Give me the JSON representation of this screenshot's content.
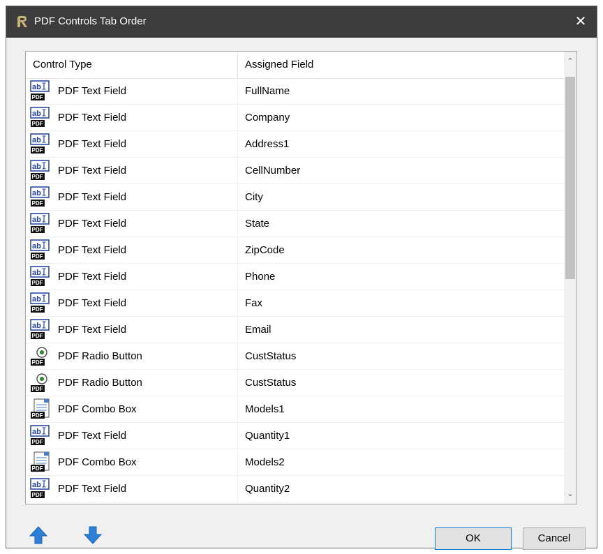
{
  "window": {
    "title": "PDF Controls Tab Order",
    "close_glyph": "✕"
  },
  "list": {
    "columns": [
      "Control Type",
      "Assigned Field"
    ],
    "rows": [
      {
        "type": "PDF Text Field",
        "field": "FullName",
        "icon": "pdf-text-field-icon"
      },
      {
        "type": "PDF Text Field",
        "field": "Company",
        "icon": "pdf-text-field-icon"
      },
      {
        "type": "PDF Text Field",
        "field": "Address1",
        "icon": "pdf-text-field-icon"
      },
      {
        "type": "PDF Text Field",
        "field": "CellNumber",
        "icon": "pdf-text-field-icon"
      },
      {
        "type": "PDF Text Field",
        "field": "City",
        "icon": "pdf-text-field-icon"
      },
      {
        "type": "PDF Text Field",
        "field": "State",
        "icon": "pdf-text-field-icon"
      },
      {
        "type": "PDF Text Field",
        "field": "ZipCode",
        "icon": "pdf-text-field-icon"
      },
      {
        "type": "PDF Text Field",
        "field": "Phone",
        "icon": "pdf-text-field-icon"
      },
      {
        "type": "PDF Text Field",
        "field": "Fax",
        "icon": "pdf-text-field-icon"
      },
      {
        "type": "PDF Text Field",
        "field": "Email",
        "icon": "pdf-text-field-icon"
      },
      {
        "type": "PDF Radio Button",
        "field": "CustStatus",
        "icon": "pdf-radio-button-icon"
      },
      {
        "type": "PDF Radio Button",
        "field": "CustStatus",
        "icon": "pdf-radio-button-icon"
      },
      {
        "type": "PDF Combo Box",
        "field": "Models1",
        "icon": "pdf-combo-box-icon"
      },
      {
        "type": "PDF Text Field",
        "field": "Quantity1",
        "icon": "pdf-text-field-icon"
      },
      {
        "type": "PDF Combo Box",
        "field": "Models2",
        "icon": "pdf-combo-box-icon"
      },
      {
        "type": "PDF Text Field",
        "field": "Quantity2",
        "icon": "pdf-text-field-icon"
      }
    ]
  },
  "icon_labels": {
    "text": "ab",
    "pdf": "PDF"
  },
  "scrollbar": {
    "up_glyph": "⌃",
    "down_glyph": "⌄"
  },
  "buttons": {
    "ok": "OK",
    "cancel": "Cancel"
  },
  "colors": {
    "titlebar": "#3c3c3c",
    "arrow": "#2e7fd6",
    "ok_border": "#0078d7"
  }
}
